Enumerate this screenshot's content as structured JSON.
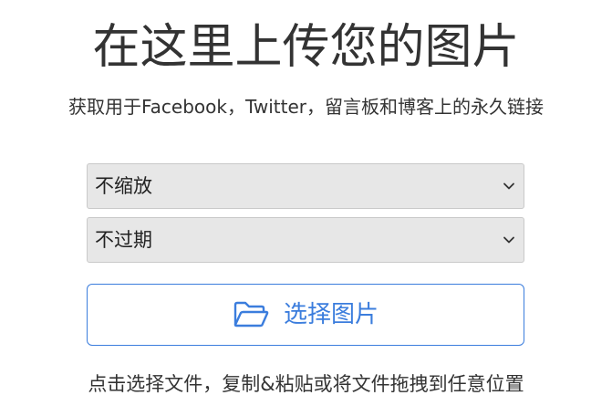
{
  "header": {
    "title": "在这里上传您的图片",
    "subtitle": "获取用于Facebook，Twitter，留言板和博客上的永久链接"
  },
  "form": {
    "resize_select": {
      "value": "不缩放",
      "icon": "chevron-down-icon"
    },
    "expiry_select": {
      "value": "不过期",
      "icon": "chevron-down-icon"
    },
    "upload_button": {
      "label": "选择图片",
      "icon": "folder-open-icon"
    }
  },
  "hint": "点击选择文件，复制&粘贴或将文件拖拽到任意位置",
  "colors": {
    "accent": "#3b7ddd",
    "select_bg": "#e7e7e7",
    "text": "#333333"
  }
}
